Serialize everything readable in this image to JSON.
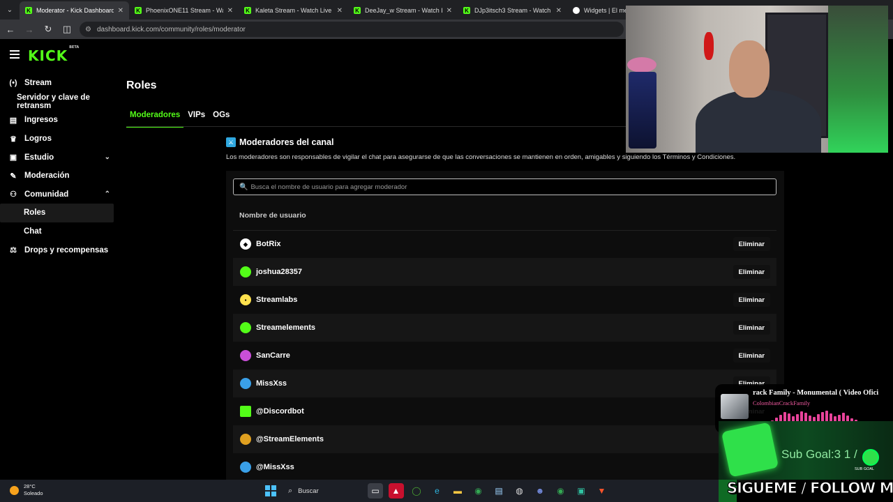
{
  "browser": {
    "tabs": [
      {
        "label": "Moderator - Kick Dashboard",
        "active": true
      },
      {
        "label": "PhoenixONE11 Stream - Watch",
        "active": false
      },
      {
        "label": "Kaleta Stream - Watch Live on K",
        "active": false
      },
      {
        "label": "DeeJay_w Stream - Watch Live",
        "active": false
      },
      {
        "label": "DJp3itsch3 Stream - Watch Live",
        "active": false
      },
      {
        "label": "Widgets | El mej",
        "active": false
      }
    ],
    "url": "dashboard.kick.com/community/roles/moderator"
  },
  "brand": {
    "logo": "KICK",
    "badge": "BETA",
    "accent": "#53fc18"
  },
  "sidebar": {
    "items": [
      {
        "label": "Stream",
        "icon": "broadcast-icon",
        "glyph": "(•)"
      },
      {
        "label": "Servidor y clave de retransm",
        "sub": true
      },
      {
        "label": "Ingresos",
        "icon": "wallet-icon",
        "glyph": "▤"
      },
      {
        "label": "Logros",
        "icon": "trophy-icon",
        "glyph": "🏆"
      },
      {
        "label": "Estudio",
        "icon": "studio-icon",
        "glyph": "▣",
        "chevron": "⌄"
      },
      {
        "label": "Moderación",
        "icon": "wrench-icon",
        "glyph": "✎"
      },
      {
        "label": "Comunidad",
        "icon": "community-icon",
        "glyph": "👥",
        "chevron": "⌃"
      },
      {
        "label": "Roles",
        "child": true,
        "active": true
      },
      {
        "label": "Chat",
        "child": true
      },
      {
        "label": "Drops y recompensas",
        "icon": "drops-icon",
        "glyph": "⚖"
      }
    ]
  },
  "page": {
    "title": "Roles",
    "tabs": [
      "Moderadores",
      "VIPs",
      "OGs"
    ],
    "section_title": "Moderadores del canal",
    "section_desc": "Los moderadores son responsables de vigilar el chat para asegurarse de que las conversaciones se mantienen en orden, amigables y siguiendo los Términos y Condiciones.",
    "search_placeholder": "Busca el nombre de usuario para agregar moderador",
    "column_header": "Nombre de usuario",
    "delete_label": "Eliminar",
    "moderators": [
      {
        "name": "BotRix",
        "color": "#ffffff"
      },
      {
        "name": "joshua28357",
        "color": "#53fc18"
      },
      {
        "name": "Streamlabs",
        "color": "#ffe14d"
      },
      {
        "name": "Streamelements",
        "color": "#53fc18"
      },
      {
        "name": "SanCarre",
        "color": "#c94fd8"
      },
      {
        "name": "MissXss",
        "color": "#3aa0e8"
      },
      {
        "name": "@Discordbot",
        "color": "#53fc18"
      },
      {
        "name": "@StreamElements",
        "color": "#e0a020"
      },
      {
        "name": "@MissXss",
        "color": "#3aa0e8"
      }
    ]
  },
  "overlay": {
    "song_title": "rack Family - Monumental ( Video Ofici",
    "song_artist": "ColombianCrackFamily",
    "sub_goal": "Sub Goal:3  1 /",
    "sub_goal_label": "SUB GOAL",
    "follow_text": "SIGUEME / FOLLOW ME"
  },
  "taskbar": {
    "temperature": "28°C",
    "weather": "Soleado",
    "search_label": "Buscar"
  }
}
